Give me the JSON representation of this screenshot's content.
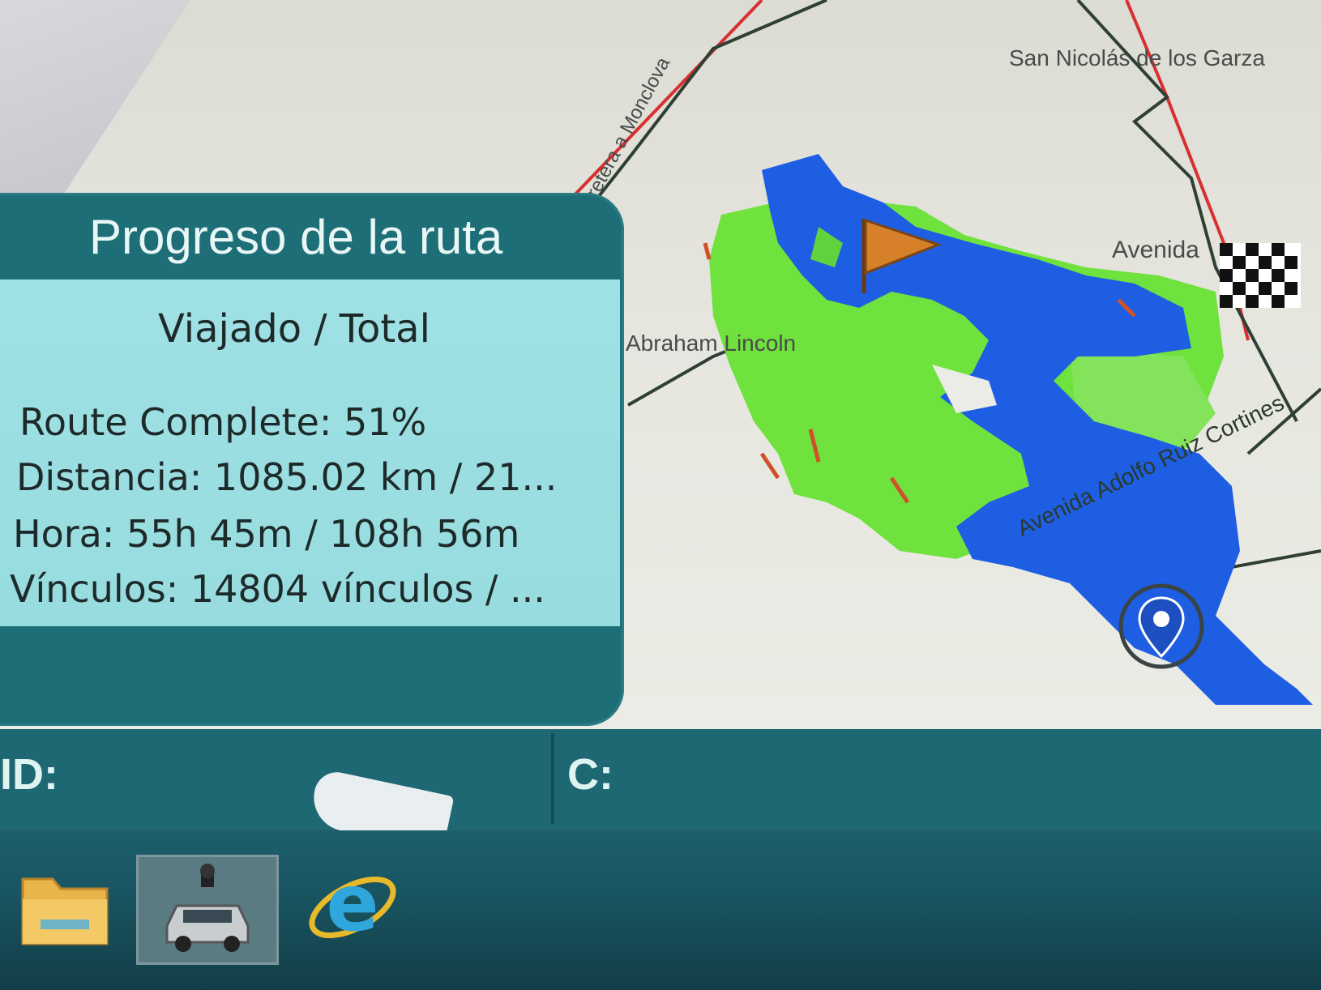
{
  "map": {
    "labels": {
      "san_nicolas": "San Nicolás de los Garza",
      "abraham_lincoln": "Abraham Lincoln",
      "carretera": "Carretera a Monclova",
      "avenida": "Avenida",
      "avenida_ruiz": "Avenida Adolfo Ruiz Cortines"
    },
    "icons": {
      "start": "orange-flag-icon",
      "finish": "checkered-flag-icon",
      "current": "location-pin-icon"
    },
    "colors": {
      "traveled": "#1a5ce0",
      "remaining": "#6ee03c",
      "highway": "#e03030",
      "road": "#2a3a2a"
    }
  },
  "panel": {
    "title": "Progreso de la ruta",
    "subtitle": "Viajado / Total",
    "route_complete": "Route Complete: 51%",
    "distance": "Distancia: 1085.02 km / 21...",
    "time": "Hora: 55h 45m / 108h 56m",
    "links": "Vínculos: 14804 vínculos / ..."
  },
  "status": {
    "id_label": "ID:",
    "c_label": "C:"
  },
  "taskbar": {
    "items": [
      {
        "icon": "folder-icon"
      },
      {
        "icon": "car-camera-icon",
        "active": true
      },
      {
        "icon": "internet-explorer-icon"
      }
    ]
  }
}
